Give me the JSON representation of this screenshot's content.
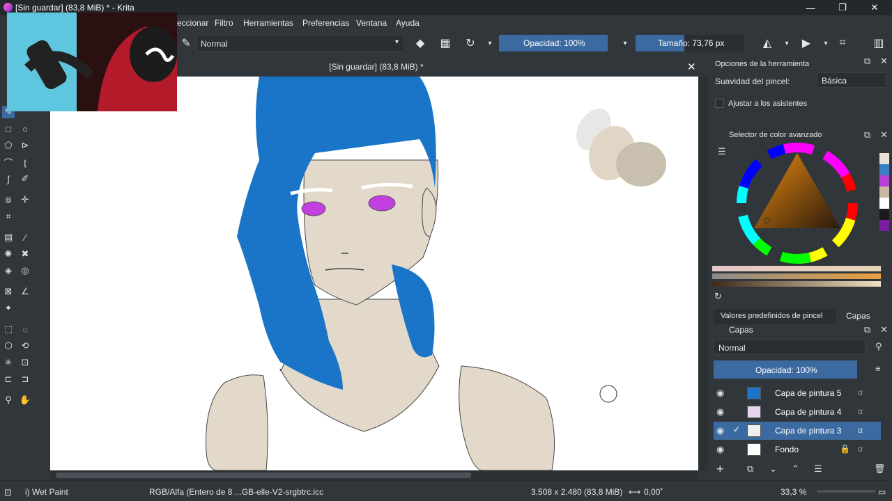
{
  "window": {
    "title": "[Sin guardar]  (83,8 MiB) * - Krita",
    "minimize": "—",
    "maximize": "❐",
    "close": "✕"
  },
  "menu": {
    "items": [
      "eccionar",
      "Filtro",
      "Herramientas",
      "Preferencias",
      "Ventana",
      "Ayuda"
    ]
  },
  "toolbar": {
    "blend_mode": "Normal",
    "opacity_label": "Opacidad: 100%",
    "size_label": "Tamaño: 73,76 px"
  },
  "document": {
    "title": "[Sin guardar]  (83,8 MiB) *",
    "close": "✕"
  },
  "tool_options": {
    "title": "Opciones de la herramienta",
    "smoothing_label": "Suavidad del pincel:",
    "smoothing_value": "Básica",
    "snap_label": "Ajustar a los asistentes"
  },
  "color_selector": {
    "title": "Selector de color avanzado",
    "swatches": [
      "#e8e1d5",
      "#3a7fc4",
      "#b63fd8",
      "#c9b9a2",
      "#ffffff",
      "#1a1a1a",
      "#7a1fa0"
    ]
  },
  "tabs": {
    "presets": "Valores predefinidos de pincel",
    "layers": "Capas"
  },
  "layers_docker": {
    "title": "Capas",
    "blend_mode": "Normal",
    "opacity_label": "Opacidad:  100%",
    "layers": [
      {
        "name": "Capa de pintura 5",
        "active": false
      },
      {
        "name": "Capa de pintura 4",
        "active": false
      },
      {
        "name": "Capa de pintura 3",
        "active": true
      },
      {
        "name": "Fondo",
        "active": false
      }
    ]
  },
  "status": {
    "brush": "i) Wet Paint",
    "color_space": "RGB/Alfa (Entero de 8 ...GB-elle-V2-srgbtrc.icc",
    "dimensions": "3.508 x 2.480 (83,8 MiB)",
    "rotation": "0,00˚",
    "zoom": "33,3 %"
  },
  "colors": {
    "accent": "#3b6aa0",
    "hair": "#1a75c9",
    "skin": "#e3d9ca",
    "eyes": "#c33fe0"
  }
}
